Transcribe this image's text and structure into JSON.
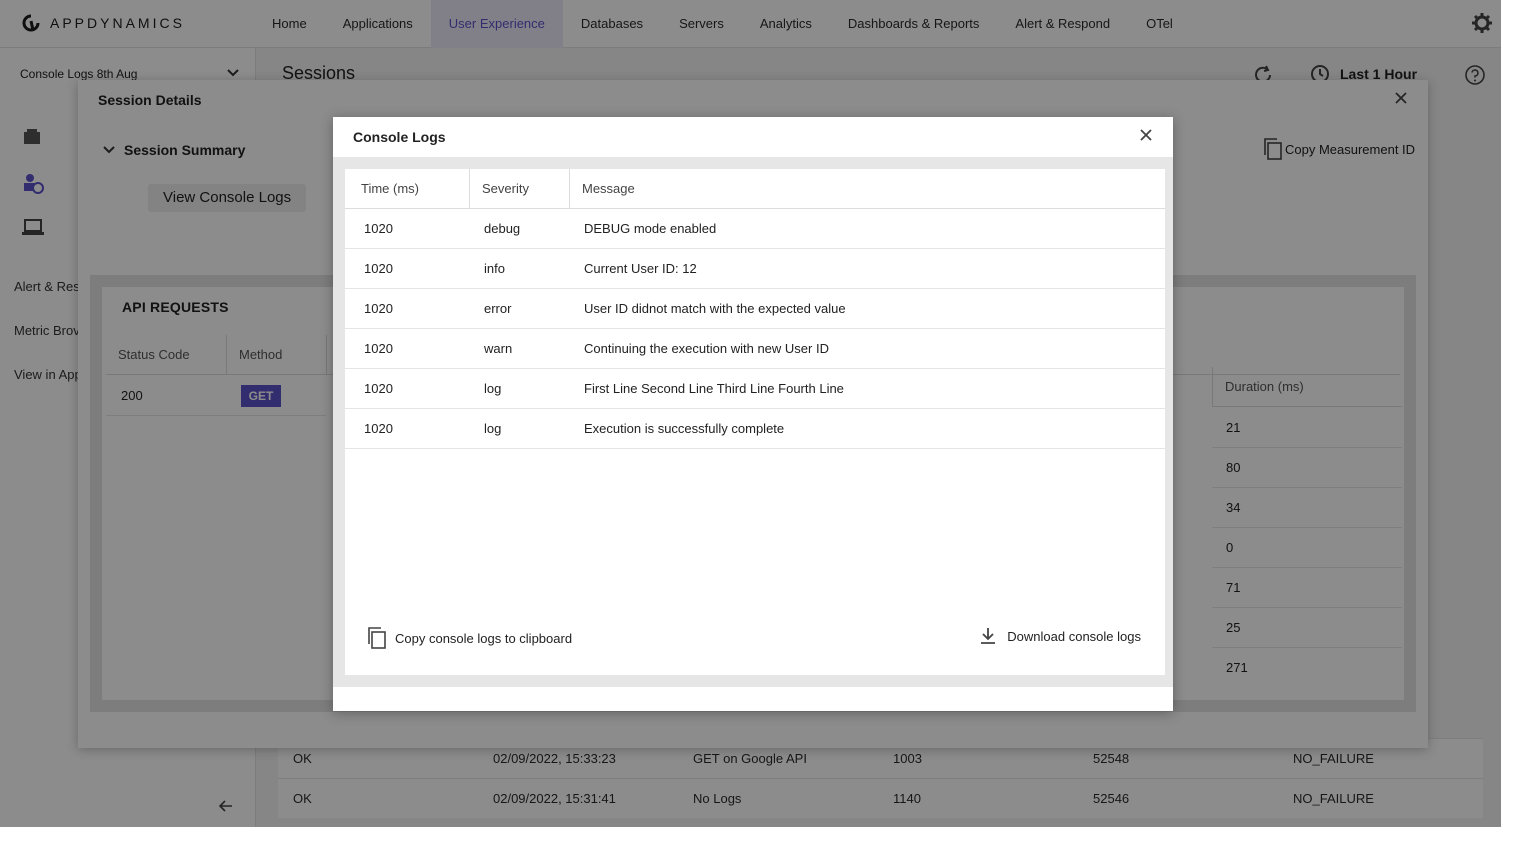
{
  "brand": {
    "name": "APPDYNAMICS"
  },
  "nav": {
    "items": [
      "Home",
      "Applications",
      "User Experience",
      "Databases",
      "Servers",
      "Analytics",
      "Dashboards & Reports",
      "Alert & Respond",
      "OTel"
    ],
    "active": "User Experience"
  },
  "sidebar": {
    "app_name": "Console Logs 8th Aug",
    "links": [
      "Alert & Res",
      "Metric Brov",
      "View in App"
    ]
  },
  "page": {
    "title": "Sessions",
    "time_range": "Last 1 Hour"
  },
  "background_table": {
    "rows": [
      [
        "OK",
        "02/09/2022, 15:33:23",
        "GET on Google API",
        "1003",
        "52548",
        "NO_FAILURE"
      ],
      [
        "OK",
        "02/09/2022, 15:31:41",
        "No Logs",
        "1140",
        "52546",
        "NO_FAILURE"
      ]
    ]
  },
  "session_details": {
    "title": "Session Details",
    "summary_label": "Session Summary",
    "view_console_logs": "View Console Logs",
    "copy_measurement_id": "Copy Measurement ID",
    "api_requests": {
      "title": "API REQUESTS",
      "columns": [
        "Status Code",
        "Method"
      ],
      "row": {
        "status": "200",
        "method": "GET"
      },
      "duration_header": "Duration (ms)",
      "durations": [
        "21",
        "80",
        "34",
        "0",
        "71",
        "25",
        "271"
      ]
    }
  },
  "console_logs": {
    "title": "Console Logs",
    "columns": [
      "Time (ms)",
      "Severity",
      "Message"
    ],
    "rows": [
      {
        "time": "1020",
        "severity": "debug",
        "message": "DEBUG mode enabled"
      },
      {
        "time": "1020",
        "severity": "info",
        "message": "Current User ID: 12"
      },
      {
        "time": "1020",
        "severity": "error",
        "message": "User ID didnot match with the expected value"
      },
      {
        "time": "1020",
        "severity": "warn",
        "message": "Continuing the execution with new User ID"
      },
      {
        "time": "1020",
        "severity": "log",
        "message": "First Line Second Line Third Line Fourth Line"
      },
      {
        "time": "1020",
        "severity": "log",
        "message": "Execution is successfully complete"
      }
    ],
    "copy_label": "Copy console logs to clipboard",
    "download_label": "Download console logs"
  },
  "colors": {
    "accent": "#5b52c9",
    "overlay": "rgba(0,0,0,0.45)"
  },
  "icons": [
    "appd-logo-icon",
    "gear-icon",
    "chevron-down-icon",
    "refresh-icon",
    "clock-icon",
    "help-icon",
    "close-icon",
    "copy-icon",
    "filter-icon",
    "download-icon",
    "arrow-left-icon"
  ]
}
